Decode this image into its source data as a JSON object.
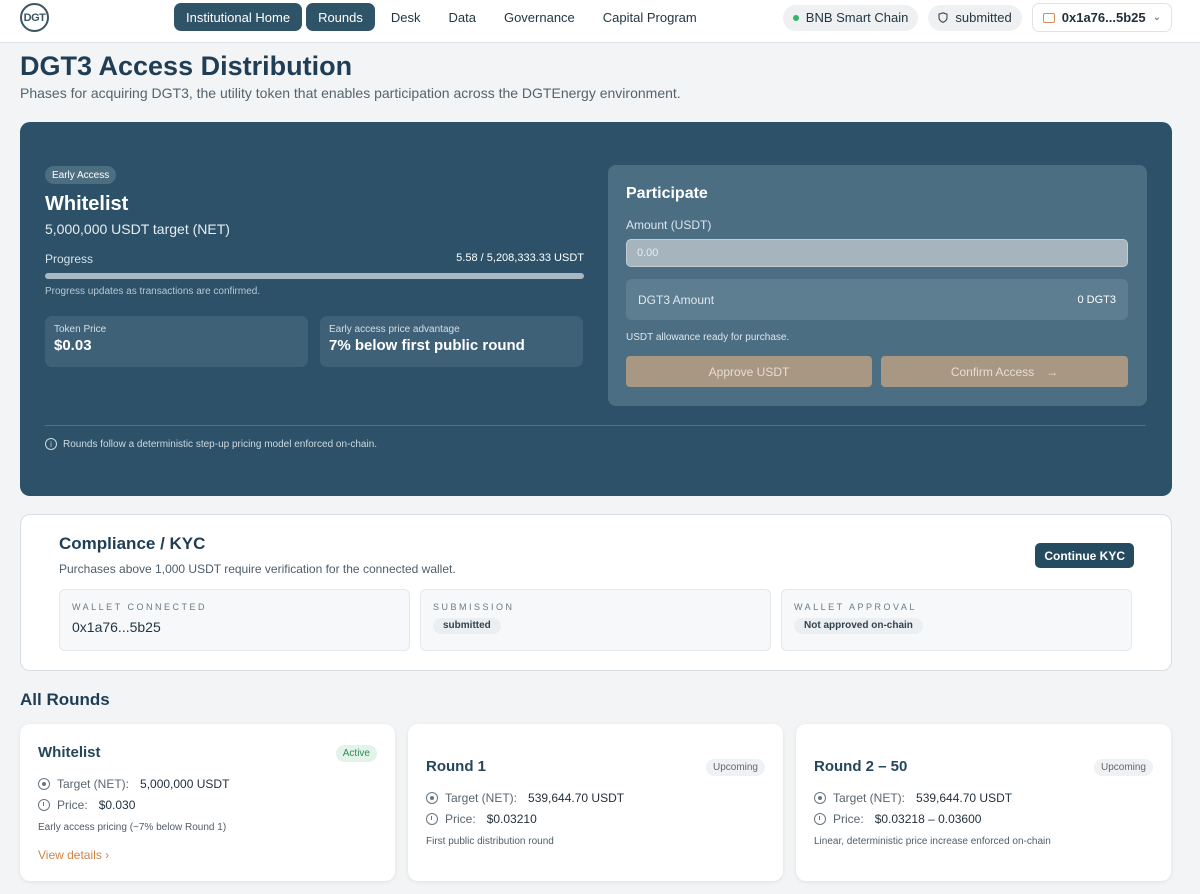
{
  "nav": {
    "logo_text": "DGT",
    "items": [
      {
        "label": "Institutional Home",
        "active": true
      },
      {
        "label": "Rounds",
        "active": true
      },
      {
        "label": "Desk",
        "active": false
      },
      {
        "label": "Data",
        "active": false
      },
      {
        "label": "Governance",
        "active": false
      },
      {
        "label": "Capital Program",
        "active": false
      }
    ],
    "network": "BNB Smart Chain",
    "status": "submitted",
    "wallet": "0x1a76...5b25"
  },
  "header": {
    "title": "DGT3 Access Distribution",
    "subtitle": "Phases for acquiring DGT3, the utility token that enables participation across the DGTEnergy environment."
  },
  "hero": {
    "badge": "Early Access",
    "title": "Whitelist",
    "target": "5,000,000 USDT target (NET)",
    "progress_label": "Progress",
    "progress_raised": "5.58",
    "progress_separator": "/",
    "progress_total": "5,208,333.33 USDT",
    "progress_fraction": 1e-06,
    "progress_note": "Progress updates as transactions are confirmed.",
    "token_price_label": "Token Price",
    "token_price_value": "$0.03",
    "advantage_label": "Early access price advantage",
    "advantage_value": "7% below first public round",
    "footer_note": "Rounds follow a deterministic step-up pricing model enforced on-chain."
  },
  "participate": {
    "title": "Participate",
    "amount_label": "Amount (USDT)",
    "amount_placeholder": "0.00",
    "dgt3_label": "DGT3 Amount",
    "dgt3_value": "0 DGT3",
    "allowance_note": "USDT allowance ready for purchase.",
    "approve_label": "Approve USDT",
    "confirm_label": "Confirm Access"
  },
  "compliance": {
    "title": "Compliance / KYC",
    "subtitle": "Purchases above 1,000 USDT require verification for the connected wallet.",
    "button": "Continue KYC",
    "cards": [
      {
        "label": "WALLET CONNECTED",
        "value": "0x1a76...5b25"
      },
      {
        "label": "SUBMISSION",
        "value": "submitted"
      },
      {
        "label": "WALLET APPROVAL",
        "value": "Not approved on-chain"
      }
    ]
  },
  "rounds": {
    "title": "All Rounds",
    "target_label": "Target (NET):",
    "price_label": "Price:",
    "items": [
      {
        "name": "Whitelist",
        "status": "Active",
        "target": "5,000,000 USDT",
        "price": "$0.030",
        "description": "Early access pricing (~7% below Round 1)",
        "link": "View details"
      },
      {
        "name": "Round 1",
        "status": "Upcoming",
        "target": "539,644.70 USDT",
        "price": "$0.03210",
        "description": "First public distribution round"
      },
      {
        "name": "Round 2 – 50",
        "status": "Upcoming",
        "target": "539,644.70 USDT",
        "price": "$0.03218 – 0.03600",
        "description": "Linear, deterministic price increase enforced on-chain"
      }
    ]
  }
}
